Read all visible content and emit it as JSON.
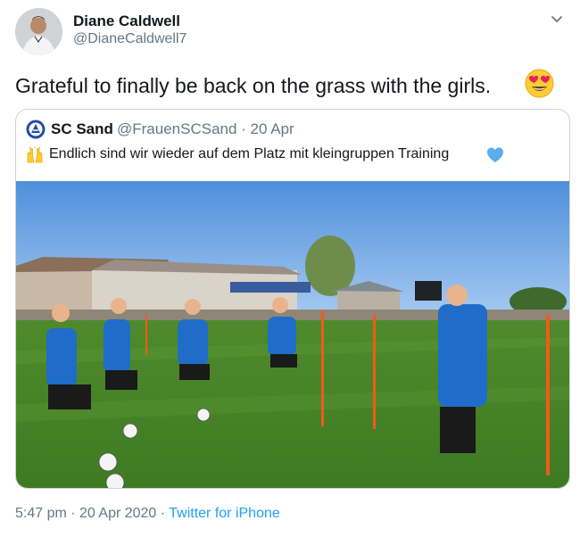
{
  "author": {
    "display_name": "Diane Caldwell",
    "handle": "@DianeCaldwell7",
    "avatar_icon": "profile-photo"
  },
  "tweet": {
    "text": "Grateful to finally be back on the grass with the girls.",
    "emoji": "heart-eyes-emoji"
  },
  "quoted_tweet": {
    "account_name": "SC Sand",
    "handle_and_date": "@FrauenSCSand · 20 Apr",
    "text": "Endlich sind wir wieder auf dem Platz mit kleingruppen Training",
    "lead_emoji": "raised-hands-emoji",
    "trail_emoji": "blue-heart-emoji",
    "logo_icon": "club-crest",
    "photo_description_icon": "team-training-photo"
  },
  "footer": {
    "time_date": "5:47 pm · 20 Apr 2020 · ",
    "source": "Twitter for iPhone"
  },
  "colors": {
    "link_blue": "#1da1f2",
    "secondary_text": "#657786",
    "border": "#ccd6dd"
  }
}
